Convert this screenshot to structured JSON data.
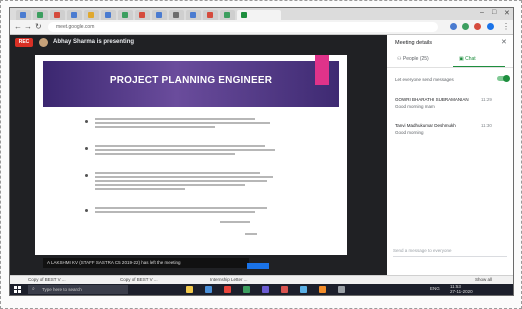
{
  "browser": {
    "tabs": [
      {
        "label": "",
        "color": "#4a7bd0"
      },
      {
        "label": "",
        "color": "#3c9e5f"
      },
      {
        "label": "",
        "color": "#d54b3d"
      },
      {
        "label": "",
        "color": "#4a7bd0"
      },
      {
        "label": "",
        "color": "#e0a82e"
      },
      {
        "label": "",
        "color": "#4a7bd0"
      },
      {
        "label": "",
        "color": "#3c9e5f"
      },
      {
        "label": "",
        "color": "#d54b3d"
      },
      {
        "label": "",
        "color": "#4a7bd0"
      },
      {
        "label": "",
        "color": "#6c6c6c"
      },
      {
        "label": "",
        "color": "#4a7bd0"
      },
      {
        "label": "",
        "color": "#d54b3d"
      },
      {
        "label": "",
        "color": "#3c9e5f"
      }
    ],
    "active_tab_label": "",
    "url": "meet.google.com",
    "controls": {
      "minimize": "–",
      "maximize": "□",
      "close": "✕"
    }
  },
  "meet": {
    "rec_label": "REC",
    "presenter_text": "Abhay Sharma is presenting",
    "toast_text": "A LAKSHMI KV (STAFF SASTRA C5 2019-22) has left the meeting"
  },
  "slide": {
    "title": "PROJECT PLANNING ENGINEER",
    "accent_color": "#e0338a",
    "banner_color": "#4b3183"
  },
  "panel": {
    "title": "Meeting details",
    "tabs": [
      {
        "label": "People (25)",
        "icon": "people-icon"
      },
      {
        "label": "Chat",
        "icon": "chat-icon"
      }
    ],
    "toggle_label": "Let everyone send messages",
    "messages": [
      {
        "name": "GOWRI BHARATHI SUBRAMANIAN",
        "time": "11:29",
        "text": "Good morning mam"
      },
      {
        "name": "Tanvi Madhukumar Deshmukh",
        "time": "11:30",
        "text": "Good morning"
      }
    ],
    "input_placeholder": "Send a message to everyone"
  },
  "downloads": {
    "items": [
      "Copy of BEST V ...",
      "Copy of BEST V ...",
      "Internship Letter ..."
    ],
    "show_all": "Show all"
  },
  "taskbar": {
    "search_placeholder": "Type here to search",
    "time": "11:53",
    "date": "27-11-2020",
    "lang": "ENG",
    "app_colors": [
      "#f2c94c",
      "#4a90d9",
      "#e8453c",
      "#3c9e5f",
      "#6b5bd2",
      "#d9534f",
      "#5ab0e6",
      "#f28c28",
      "#9aa0a6"
    ]
  }
}
